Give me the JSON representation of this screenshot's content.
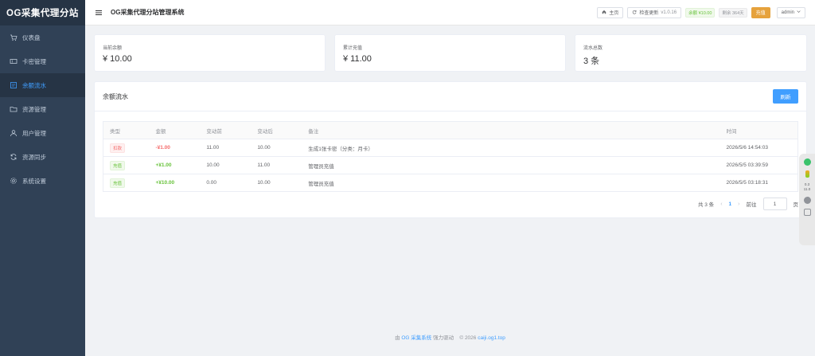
{
  "sidebar": {
    "logo": "OG采集代理分站",
    "items": [
      {
        "label": "仪表盘",
        "icon": "cart-icon"
      },
      {
        "label": "卡密管理",
        "icon": "ticket-icon"
      },
      {
        "label": "余额流水",
        "icon": "receipt-icon",
        "active": true
      },
      {
        "label": "资源管理",
        "icon": "folder-icon"
      },
      {
        "label": "用户管理",
        "icon": "user-icon"
      },
      {
        "label": "资源同步",
        "icon": "sync-icon"
      },
      {
        "label": "系统设置",
        "icon": "gear-icon"
      }
    ]
  },
  "header": {
    "title": "OG采集代理分站管理系统",
    "home_label": "主页",
    "update_label": "检查更新",
    "version": "v1.0.16",
    "balance_tag": "余额 ¥10.00",
    "remaining_tag": "剩余 364天",
    "recharge_label": "充值",
    "user": "admin"
  },
  "stats": [
    {
      "label": "当前余额",
      "value": "¥ 10.00"
    },
    {
      "label": "累计充值",
      "value": "¥ 11.00"
    },
    {
      "label": "流水总数",
      "value": "3 条"
    }
  ],
  "card": {
    "title": "余额流水",
    "refresh_label": "刷新"
  },
  "table": {
    "headers": [
      "类型",
      "金额",
      "变动前",
      "变动后",
      "备注",
      "时间"
    ],
    "rows": [
      {
        "type": "扣款",
        "type_color": "red",
        "amount": "-¥1.00",
        "before": "11.00",
        "after": "10.00",
        "note": "生成1张卡密（分类：月卡）",
        "time": "2026/5/6 14:54:03"
      },
      {
        "type": "充值",
        "type_color": "green",
        "amount": "+¥1.00",
        "before": "10.00",
        "after": "11.00",
        "note": "管理员充值",
        "time": "2026/5/5 03:39:59"
      },
      {
        "type": "充值",
        "type_color": "green",
        "amount": "+¥10.00",
        "before": "0.00",
        "after": "10.00",
        "note": "管理员充值",
        "time": "2026/5/5 03:18:31"
      }
    ]
  },
  "pager": {
    "total": "共 3 条",
    "current": "1",
    "goto_label": "前往",
    "goto_value": "1",
    "page_suffix": "页"
  },
  "footer": {
    "prefix": "由",
    "brand": "OG 采集系统",
    "middle": "强力驱动",
    "copyright": "© 2026",
    "site": "caiji.og1.top"
  },
  "floatbar": {
    "up": "0.3",
    "down": "11.0"
  },
  "colors": {
    "sidebar_bg": "#304156",
    "primary": "#409eff",
    "warning": "#e6a23c",
    "success": "#67c23a",
    "danger": "#f56c6c"
  }
}
